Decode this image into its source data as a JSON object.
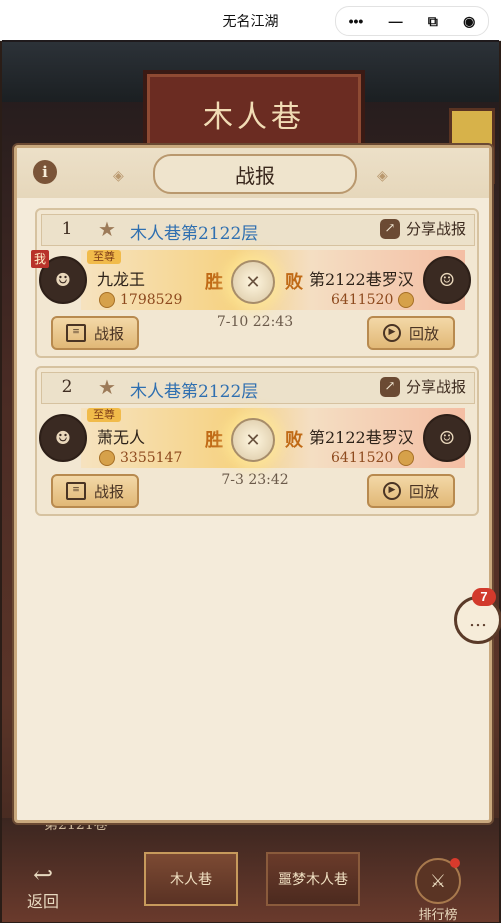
{
  "window": {
    "title": "无名江湖",
    "capsule": {
      "more": "•••",
      "minimize": "—",
      "restore": "⧉",
      "close": "◉"
    }
  },
  "scene": {
    "hall_sign": "木人巷",
    "floor_label": "第2121卷"
  },
  "panel": {
    "title": "战报",
    "info_icon": "i"
  },
  "reports": [
    {
      "index": "1",
      "floor": "木人巷第2122层",
      "share_label": "分享战报",
      "left": {
        "name": "九龙王",
        "power": "1798529",
        "me_tag": "我",
        "vip_tag": "至尊"
      },
      "left_result": "胜",
      "right_result": "败",
      "right": {
        "name": "第2122巷罗汉",
        "power": "6411520"
      },
      "time": "7-10 22:43",
      "report_btn": "战报",
      "replay_btn": "回放"
    },
    {
      "index": "2",
      "floor": "木人巷第2122层",
      "share_label": "分享战报",
      "left": {
        "name": "萧无人",
        "power": "3355147",
        "vip_tag": "至尊"
      },
      "left_result": "胜",
      "right_result": "败",
      "right": {
        "name": "第2122巷罗汉",
        "power": "6411520"
      },
      "time": "7-3 23:42",
      "report_btn": "战报",
      "replay_btn": "回放"
    }
  ],
  "chat": {
    "badge": "7"
  },
  "nav": {
    "back": "返回",
    "tab1": "木人巷",
    "tab2": "噩梦木人巷",
    "rank": "排行榜"
  }
}
